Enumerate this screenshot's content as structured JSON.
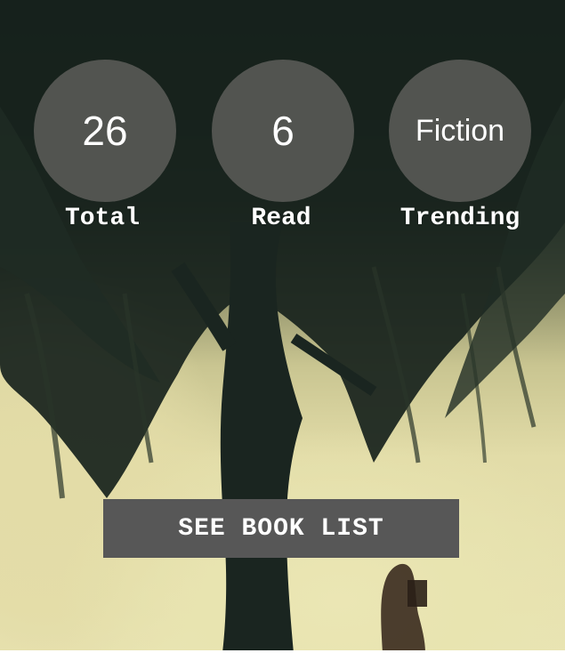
{
  "stats": [
    {
      "value": "26",
      "label": "Total"
    },
    {
      "value": "6",
      "label": "Read"
    },
    {
      "value": "Fiction",
      "label": "Trending"
    }
  ],
  "cta": {
    "label": "SEE BOOK LIST"
  },
  "background": {
    "description_icon": "tree-photo"
  },
  "colors": {
    "circle": "#5f5f5c",
    "button": "#575757",
    "text": "#ffffff"
  }
}
